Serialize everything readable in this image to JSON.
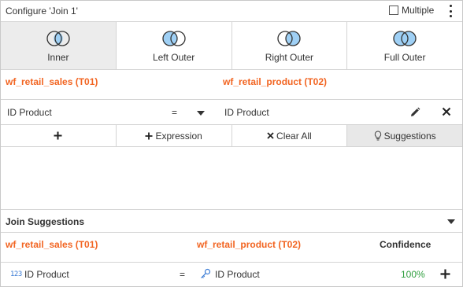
{
  "dialog": {
    "title": "Configure 'Join 1'",
    "multiple_label": "Multiple"
  },
  "join_types": [
    {
      "label": "Inner",
      "selected": true
    },
    {
      "label": "Left Outer",
      "selected": false
    },
    {
      "label": "Right Outer",
      "selected": false
    },
    {
      "label": "Full Outer",
      "selected": false
    }
  ],
  "tables": {
    "left": "wf_retail_sales (T01)",
    "right": "wf_retail_product (T02)"
  },
  "condition": {
    "left_field": "ID Product",
    "operator": "=",
    "right_field": "ID Product"
  },
  "toolbar": {
    "add_label": "",
    "expression_label": "Expression",
    "clear_all_label": "Clear All",
    "suggestions_label": "Suggestions"
  },
  "suggestions": {
    "header": "Join Suggestions",
    "left_table": "wf_retail_sales (T01)",
    "right_table": "wf_retail_product (T02)",
    "confidence_header": "Confidence",
    "rows": [
      {
        "num_icon": "123",
        "left_field": "ID Product",
        "operator": "=",
        "right_field": "ID Product",
        "confidence": "100%"
      }
    ]
  },
  "colors": {
    "accent_orange": "#f26522",
    "confidence_green": "#2e9e3e",
    "venn_fill_blue": "#9fd0f5"
  },
  "icons": [
    "checkbox-icon",
    "kebab-menu-icon",
    "venn-inner-icon",
    "venn-left-outer-icon",
    "venn-right-outer-icon",
    "venn-full-outer-icon",
    "chevron-down-icon",
    "pencil-icon",
    "close-icon",
    "plus-icon",
    "lightbulb-icon",
    "numeric-icon",
    "key-icon"
  ]
}
